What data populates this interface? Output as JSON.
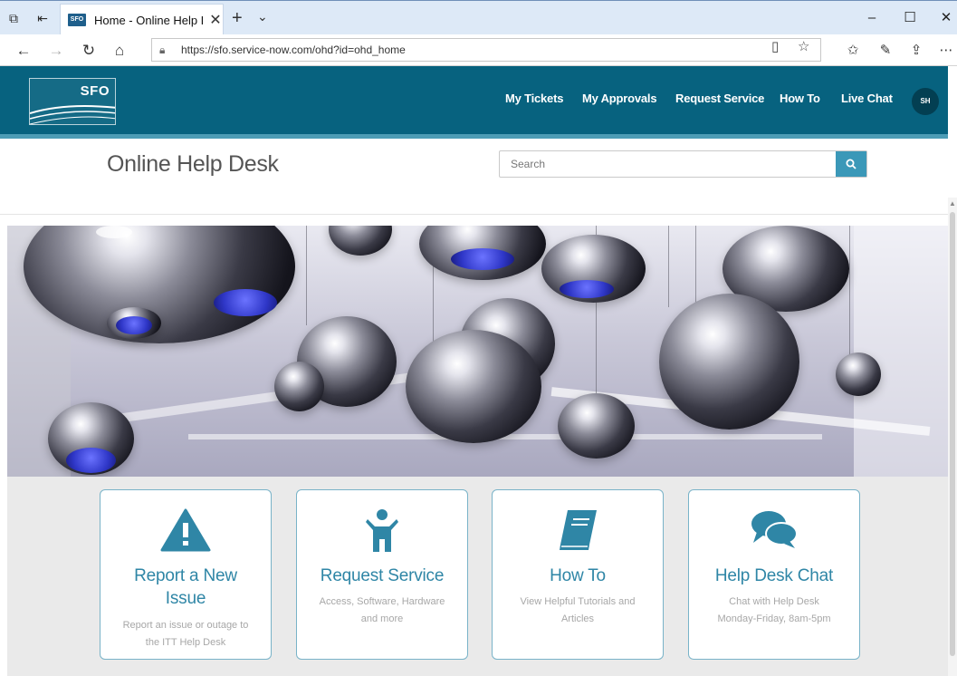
{
  "browser": {
    "tab_title": "Home - Online Help De",
    "favicon_text": "SFO",
    "url": "https://sfo.service-now.com/ohd?id=ohd_home",
    "icons": [
      "tab-sets-icon",
      "back-tabs-icon",
      "close-icon",
      "plus-icon",
      "chevron-down-icon",
      "minimize-icon",
      "maximize-icon",
      "back-arrow-icon",
      "forward-arrow-icon",
      "refresh-icon",
      "home-icon",
      "lock-icon",
      "reading-view-icon",
      "star-icon",
      "favorites-icon",
      "pen-icon",
      "share-icon",
      "more-icon"
    ]
  },
  "header": {
    "logo_text": "SFO",
    "nav": [
      "My Tickets",
      "My Approvals",
      "Request Service",
      "How To",
      "Live Chat"
    ],
    "avatar_initials": "SH"
  },
  "main": {
    "title": "Online Help Desk",
    "search_placeholder": "Search"
  },
  "cards": [
    {
      "icon": "warning-icon",
      "title_lines": [
        "Report a New",
        "Issue"
      ],
      "desc_lines": [
        "Report an issue or outage to",
        "the ITT Help Desk"
      ]
    },
    {
      "icon": "person-icon",
      "title_lines": [
        "Request Service"
      ],
      "desc_lines": [
        "Access, Software, Hardware",
        "and more"
      ]
    },
    {
      "icon": "book-icon",
      "title_lines": [
        "How To"
      ],
      "desc_lines": [
        "View Helpful Tutorials and",
        "Articles"
      ]
    },
    {
      "icon": "chat-bubbles-icon",
      "title_lines": [
        "Help Desk Chat"
      ],
      "desc_lines": [
        "Chat with Help Desk",
        "Monday-Friday, 8am-5pm"
      ]
    }
  ],
  "colors": {
    "header_bg": "#07627f",
    "accent": "#2f86a6",
    "search_button": "#3b98b8",
    "card_border": "#79b3c8",
    "desc_text": "#a7a7a7"
  }
}
